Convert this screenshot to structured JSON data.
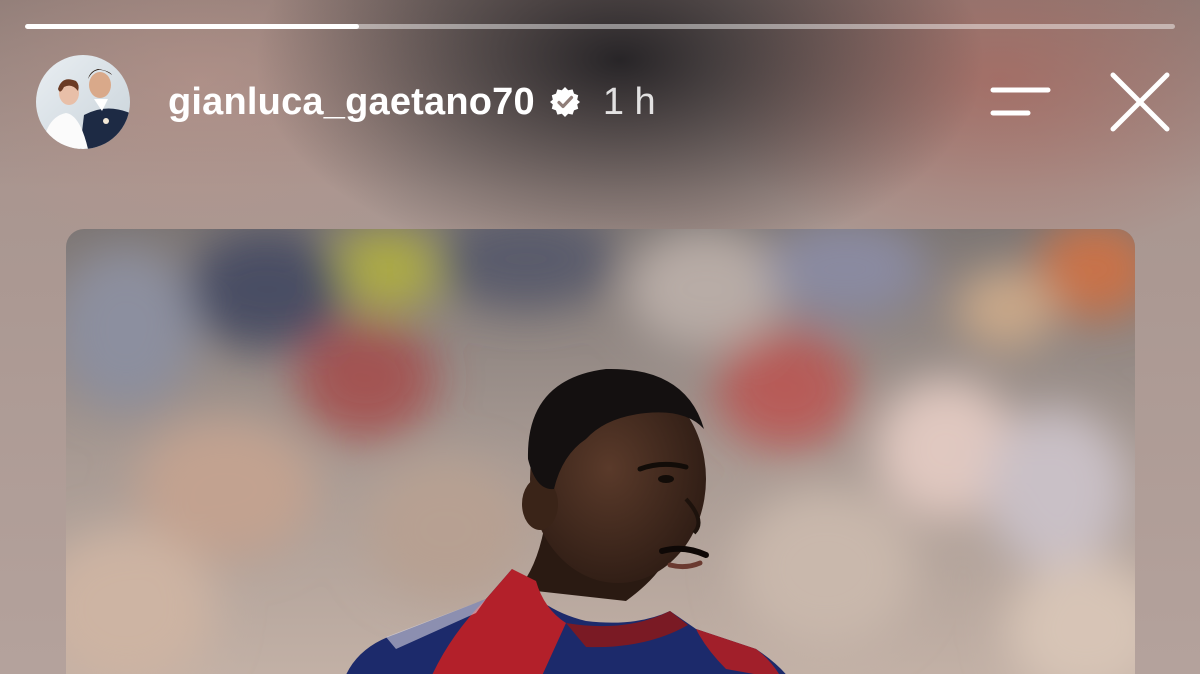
{
  "story": {
    "progress": 0.29,
    "user": {
      "username": "gianluca_gaetano70",
      "verified": true,
      "time_ago": "1 h"
    },
    "icons": {
      "verified": "verified-badge-icon",
      "menu": "menu-lines-icon",
      "close": "close-icon"
    },
    "colors": {
      "progress_fill": "#ffffff",
      "progress_track": "rgba(255,255,255,0.45)",
      "jersey_red": "#b3202a",
      "jersey_blue": "#1c2a6b"
    }
  }
}
